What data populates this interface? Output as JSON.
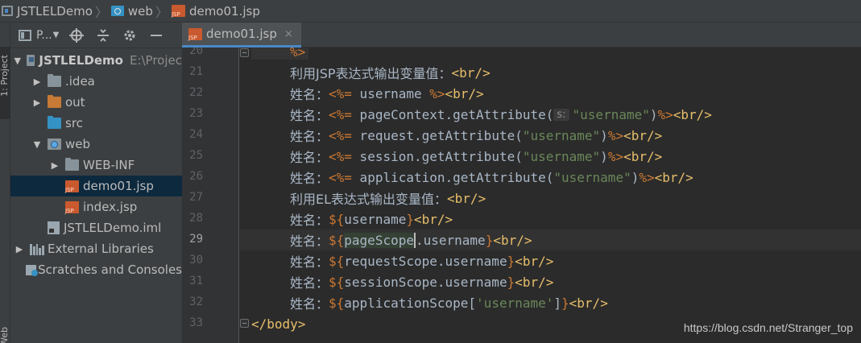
{
  "breadcrumb": {
    "project": "JSTLELDemo",
    "folder": "web",
    "file": "demo01.jsp"
  },
  "tool_stripe": {
    "project_label": "1: Project",
    "web_label": "Web"
  },
  "project_panel": {
    "title": "P...",
    "toolbar_icons": [
      "locate-icon",
      "collapse-icon",
      "gear-icon",
      "hide-icon"
    ],
    "tree": [
      {
        "label": "JSTLELDemo",
        "extra": "E:\\Projec",
        "icon": "module-icon",
        "expanded": true
      },
      {
        "label": ".idea",
        "icon": "folder-icon",
        "expanded": false
      },
      {
        "label": "out",
        "icon": "folder-orange-icon",
        "expanded": false
      },
      {
        "label": "src",
        "icon": "folder-blue-icon"
      },
      {
        "label": "web",
        "icon": "web-folder-icon",
        "expanded": true
      },
      {
        "label": "WEB-INF",
        "icon": "folder-icon",
        "expanded": false
      },
      {
        "label": "demo01.jsp",
        "icon": "jsp-icon",
        "selected": true
      },
      {
        "label": "index.jsp",
        "icon": "jsp-icon"
      },
      {
        "label": "JSTLELDemo.iml",
        "icon": "iml-icon"
      },
      {
        "label": "External Libraries",
        "icon": "libraries-icon",
        "expanded": false
      },
      {
        "label": "Scratches and Consoles",
        "icon": "scratches-icon"
      }
    ]
  },
  "editor_tab": {
    "label": "demo01.jsp",
    "close": "×"
  },
  "editor": {
    "line_numbers": [
      "20",
      "21",
      "22",
      "23",
      "24",
      "25",
      "26",
      "27",
      "28",
      "29",
      "30",
      "31",
      "32",
      "33"
    ],
    "current_line": "29",
    "inlay_hint": "s:",
    "lines": {
      "l20_delim": "%>",
      "l21_text": "利用JSP表达式输出变量值：",
      "l21_tag": "<br/>",
      "label": "姓名：",
      "l22_open": "<%=",
      "l22_code": " username ",
      "l22_close": "%>",
      "l22_tag": "<br/>",
      "l23_code": " pageContext.getAttribute(",
      "l23_str": "\"username\"",
      "l23_paren": ")",
      "l24_code": " request.getAttribute(",
      "l25_code": " session.getAttribute(",
      "l26_code": " application.getAttribute(",
      "l27_text": "利用EL表达式输出变量值：",
      "el_open": "${",
      "el_close": "}",
      "l28_var": "username",
      "l29_var_a": "pageScope",
      "l29_var_b": ".username",
      "l30_var": "requestScope.username",
      "l31_var": "sessionScope.username",
      "l32_var_a": "applicationScope[",
      "l32_str": "'username'",
      "l32_var_b": "]",
      "l33_tag": "</body>"
    }
  },
  "watermark": "https://blog.csdn.net/Stranger_top"
}
